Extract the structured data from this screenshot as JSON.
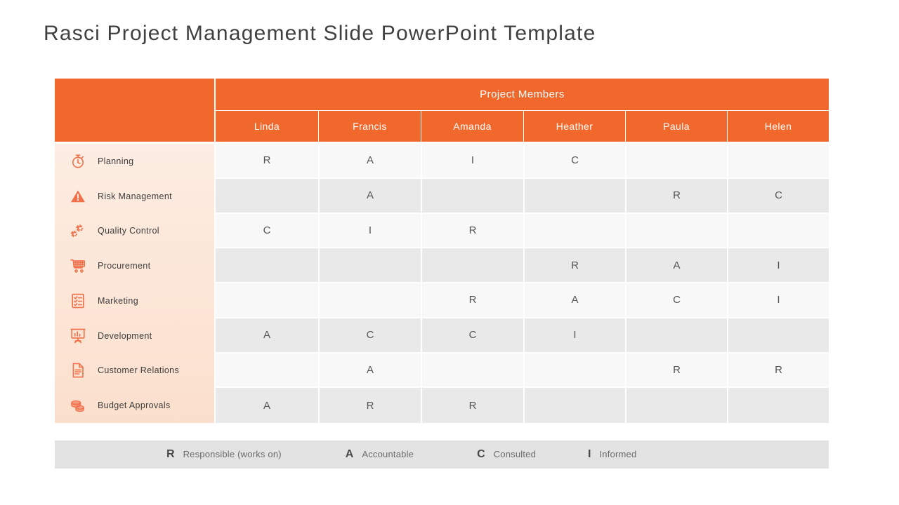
{
  "slide": {
    "title": "Rasci Project Management Slide PowerPoint Template",
    "accent_color": "#F1682C",
    "category_bg_color": "#FCE6D7",
    "row_odd_color": "#F8F8F8",
    "row_even_color": "#E9E9E9",
    "legend_bar_color": "#E3E3E3"
  },
  "table": {
    "group_header": "Project Members",
    "members": [
      "Linda",
      "Francis",
      "Amanda",
      "Heather",
      "Paula",
      "Helen"
    ],
    "categories": [
      {
        "label": "Planning",
        "icon": "stopwatch-icon"
      },
      {
        "label": "Risk Management",
        "icon": "warning-triangle-icon"
      },
      {
        "label": "Quality Control",
        "icon": "gears-icon"
      },
      {
        "label": "Procurement",
        "icon": "shopping-cart-icon"
      },
      {
        "label": "Marketing",
        "icon": "checklist-icon"
      },
      {
        "label": "Development",
        "icon": "presentation-chart-icon"
      },
      {
        "label": "Customer Relations",
        "icon": "document-icon"
      },
      {
        "label": "Budget Approvals",
        "icon": "coins-icon"
      }
    ],
    "matrix": [
      [
        "R",
        "A",
        "I",
        "C",
        "",
        ""
      ],
      [
        "",
        "A",
        "",
        "",
        "R",
        "C"
      ],
      [
        "C",
        "I",
        "R",
        "",
        "",
        ""
      ],
      [
        "",
        "",
        "",
        "R",
        "A",
        "I"
      ],
      [
        "",
        "",
        "R",
        "A",
        "C",
        "I"
      ],
      [
        "A",
        "C",
        "C",
        "I",
        "",
        ""
      ],
      [
        "",
        "A",
        "",
        "",
        "R",
        "R"
      ],
      [
        "A",
        "R",
        "R",
        "",
        "",
        ""
      ]
    ]
  },
  "legend": [
    {
      "key": "R",
      "text": "Responsible (works on)"
    },
    {
      "key": "A",
      "text": "Accountable"
    },
    {
      "key": "C",
      "text": "Consulted"
    },
    {
      "key": "I",
      "text": "Informed"
    }
  ]
}
